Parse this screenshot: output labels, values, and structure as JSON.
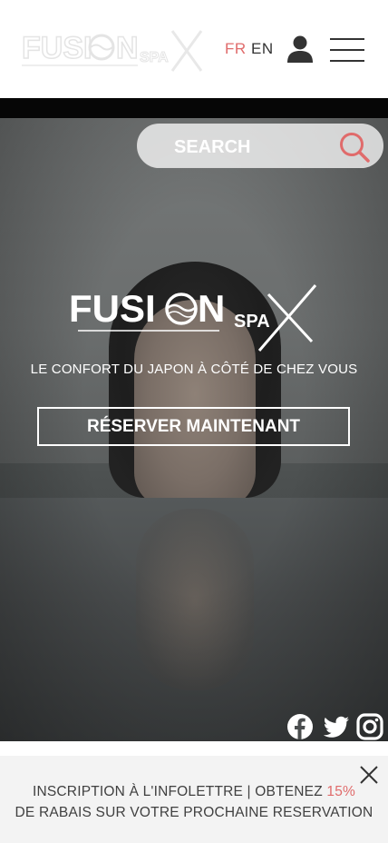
{
  "brand": {
    "logo_word": "FUSI",
    "logo_word2": "N",
    "logo_spa": "SPA",
    "accent_color": "#e06b6b"
  },
  "header": {
    "lang_fr": "FR",
    "lang_en": "EN",
    "user_icon": "user-icon",
    "menu_icon": "hamburger-menu-icon"
  },
  "search": {
    "placeholder": "SEARCH",
    "icon": "search-icon"
  },
  "hero": {
    "tagline": "LE CONFORT DU JAPON À CÔTÉ DE CHEZ VOUS",
    "cta_label": "RÉSERVER MAINTENANT"
  },
  "social": [
    "facebook-icon",
    "twitter-icon",
    "instagram-icon"
  ],
  "newsletter": {
    "line1_prefix": "INSCRIPTION À L'INFOLETTRE | OBTENEZ ",
    "line1_discount": "15%",
    "line2": "DE RABAIS SUR VOTRE PROCHAINE RESERVATION"
  }
}
